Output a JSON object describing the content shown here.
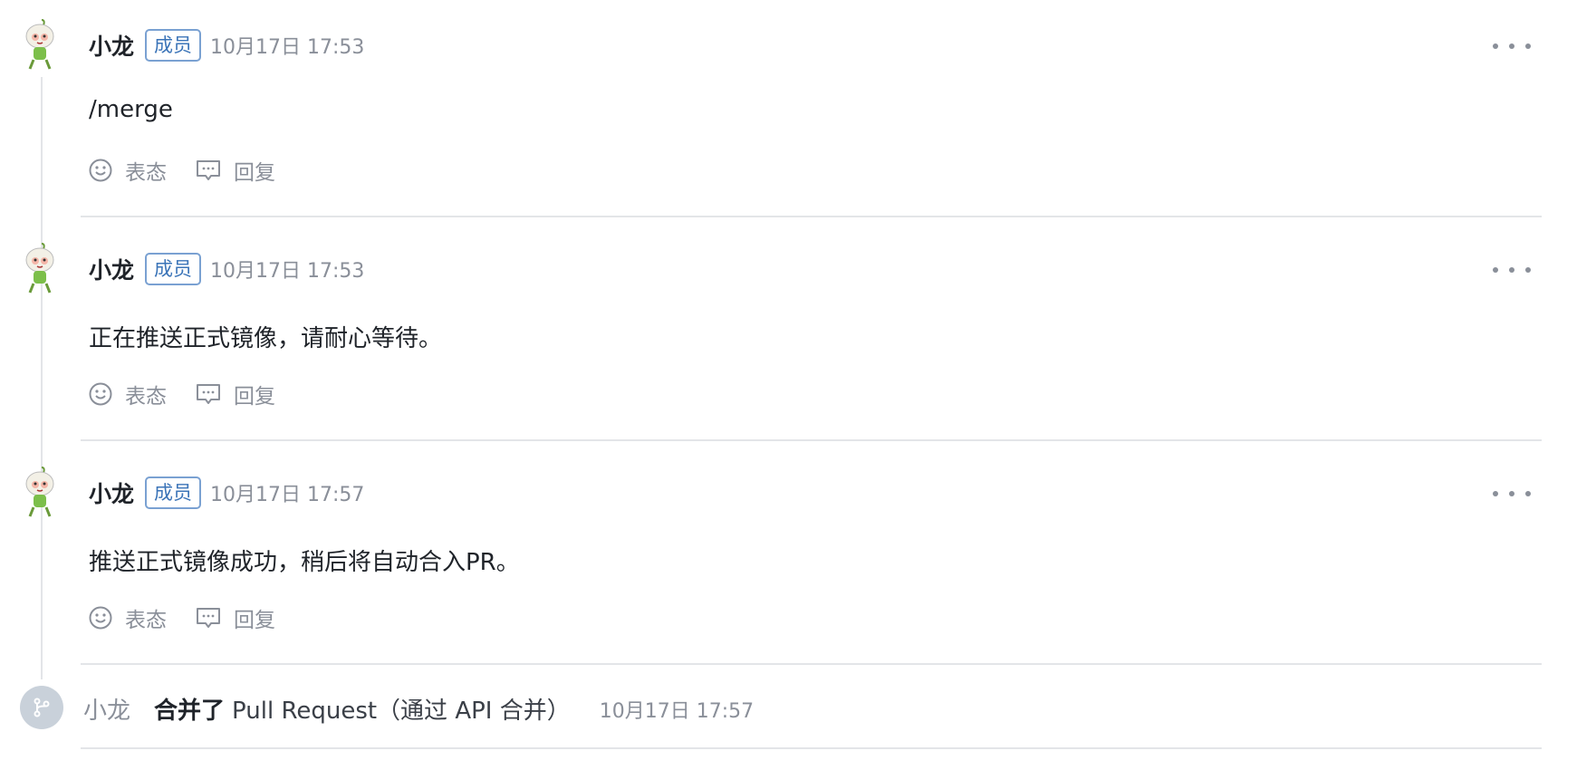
{
  "comments": [
    {
      "author": "小龙",
      "role_badge": "成员",
      "time": "10月17日 17:53",
      "body": "/merge",
      "react_label": "表态",
      "reply_label": "回复"
    },
    {
      "author": "小龙",
      "role_badge": "成员",
      "time": "10月17日 17:53",
      "body": "正在推送正式镜像，请耐心等待。",
      "react_label": "表态",
      "reply_label": "回复"
    },
    {
      "author": "小龙",
      "role_badge": "成员",
      "time": "10月17日 17:57",
      "body": "推送正式镜像成功，稍后将自动合入PR。",
      "react_label": "表态",
      "reply_label": "回复"
    }
  ],
  "merge_event": {
    "user": "小龙",
    "action": "合并了",
    "title": "Pull Request（通过 API 合并）",
    "time": "10月17日 17:57",
    "icon": "git-merge-icon"
  },
  "icons": {
    "avatar": "avatar",
    "more": "more-horizontal-icon",
    "react": "smiley-icon",
    "reply": "comment-icon"
  },
  "colors": {
    "badge_border": "#7aa1d2",
    "badge_text": "#3b74b8",
    "muted": "#8a8f99",
    "divider": "#e3e5e8",
    "merge_icon_bg": "#c9d1da"
  }
}
